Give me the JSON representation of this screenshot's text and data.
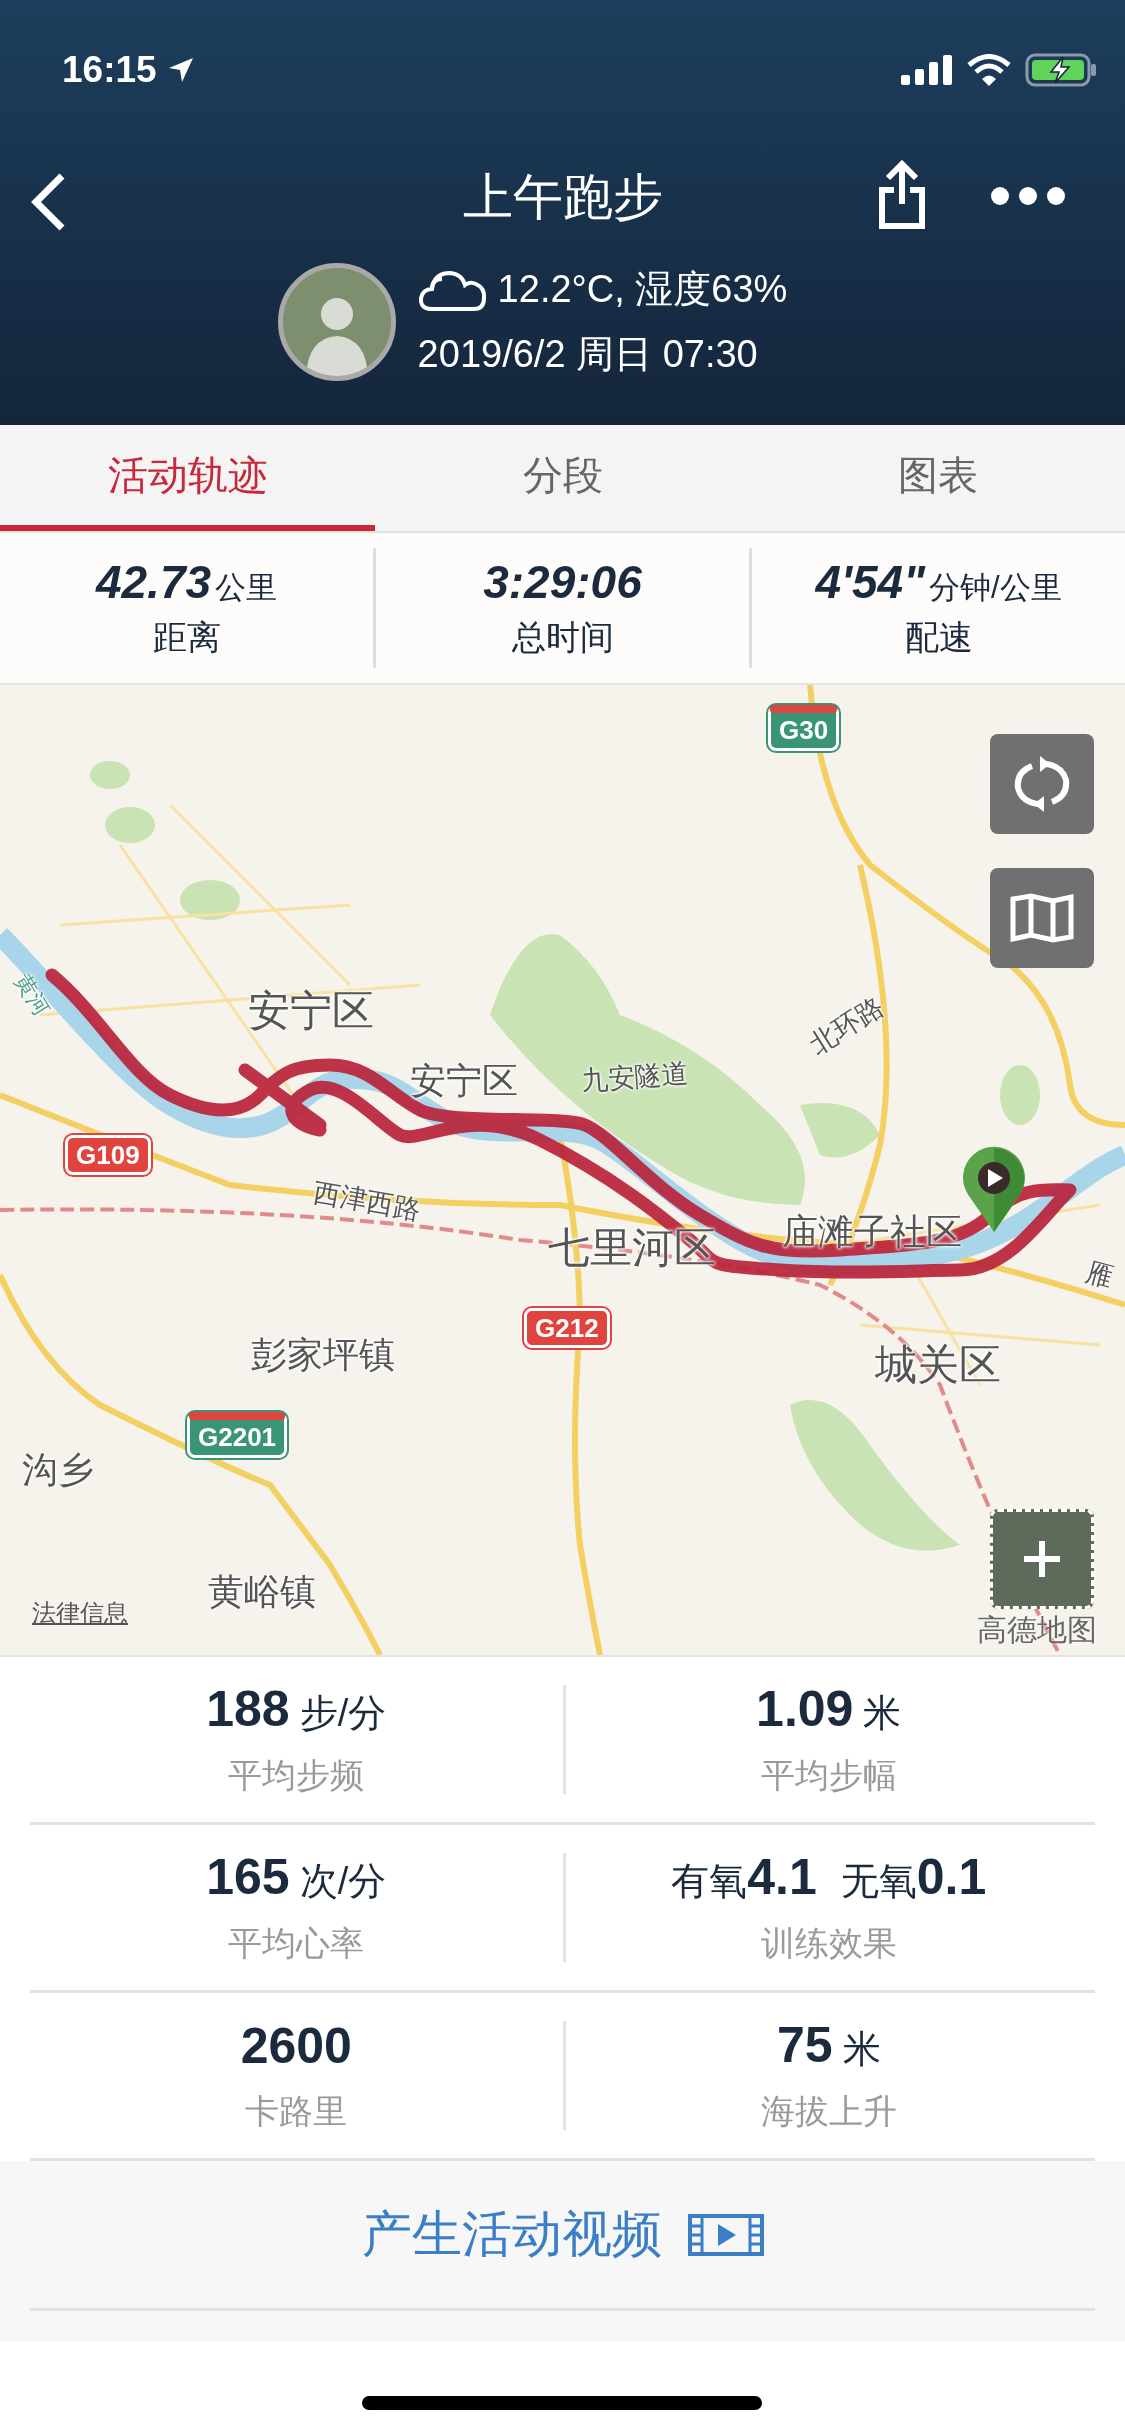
{
  "status_bar": {
    "time": "16:15"
  },
  "header": {
    "title": "上午跑步",
    "weather": "12.2°C, 湿度63%",
    "datetime": "2019/6/2 周日 07:30"
  },
  "tabs": [
    {
      "label": "活动轨迹",
      "selected": true
    },
    {
      "label": "分段",
      "selected": false
    },
    {
      "label": "图表",
      "selected": false
    }
  ],
  "summary": [
    {
      "value": "42.73",
      "unit": "公里",
      "label": "距离"
    },
    {
      "value": "3:29:06",
      "label": "总时间"
    },
    {
      "value": "4'54\"",
      "unit": "分钟/公里",
      "label": "配速"
    }
  ],
  "map": {
    "labels": [
      {
        "text": "黄河",
        "kind": "river"
      },
      {
        "text": "安宁区",
        "kind": "district"
      },
      {
        "text": "安宁区",
        "kind": "town"
      },
      {
        "text": "九安隧道",
        "kind": "road"
      },
      {
        "text": "北环路",
        "kind": "road"
      },
      {
        "text": "西津西路",
        "kind": "road"
      },
      {
        "text": "七里河区",
        "kind": "district"
      },
      {
        "text": "庙滩子社区",
        "kind": "town"
      },
      {
        "text": "城关区",
        "kind": "district"
      },
      {
        "text": "彭家坪镇",
        "kind": "town"
      },
      {
        "text": "沟乡",
        "kind": "town"
      },
      {
        "text": "黄峪镇",
        "kind": "town"
      },
      {
        "text": "雁",
        "kind": "road"
      }
    ],
    "shields": [
      {
        "text": "G30",
        "kind": "expressway"
      },
      {
        "text": "G109",
        "kind": "national"
      },
      {
        "text": "G212",
        "kind": "national"
      },
      {
        "text": "G2201",
        "kind": "expressway"
      }
    ],
    "legal_link": "法律信息",
    "attribution": "高德地图"
  },
  "metrics": [
    {
      "kind": "value",
      "value": "188",
      "unit": "步/分",
      "label": "平均步频"
    },
    {
      "kind": "value",
      "value": "1.09",
      "unit": "米",
      "label": "平均步幅"
    },
    {
      "kind": "value",
      "value": "165",
      "unit": "次/分",
      "label": "平均心率"
    },
    {
      "kind": "pairs",
      "parts": [
        {
          "prefix": "有氧",
          "value": "4.1"
        },
        {
          "prefix": "无氧",
          "value": "0.1"
        }
      ],
      "label": "训练效果"
    },
    {
      "kind": "value",
      "value": "2600",
      "label": "卡路里"
    },
    {
      "kind": "value",
      "value": "75",
      "unit": "米",
      "label": "海拔上升"
    }
  ],
  "video_button": {
    "label": "产生活动视频"
  }
}
